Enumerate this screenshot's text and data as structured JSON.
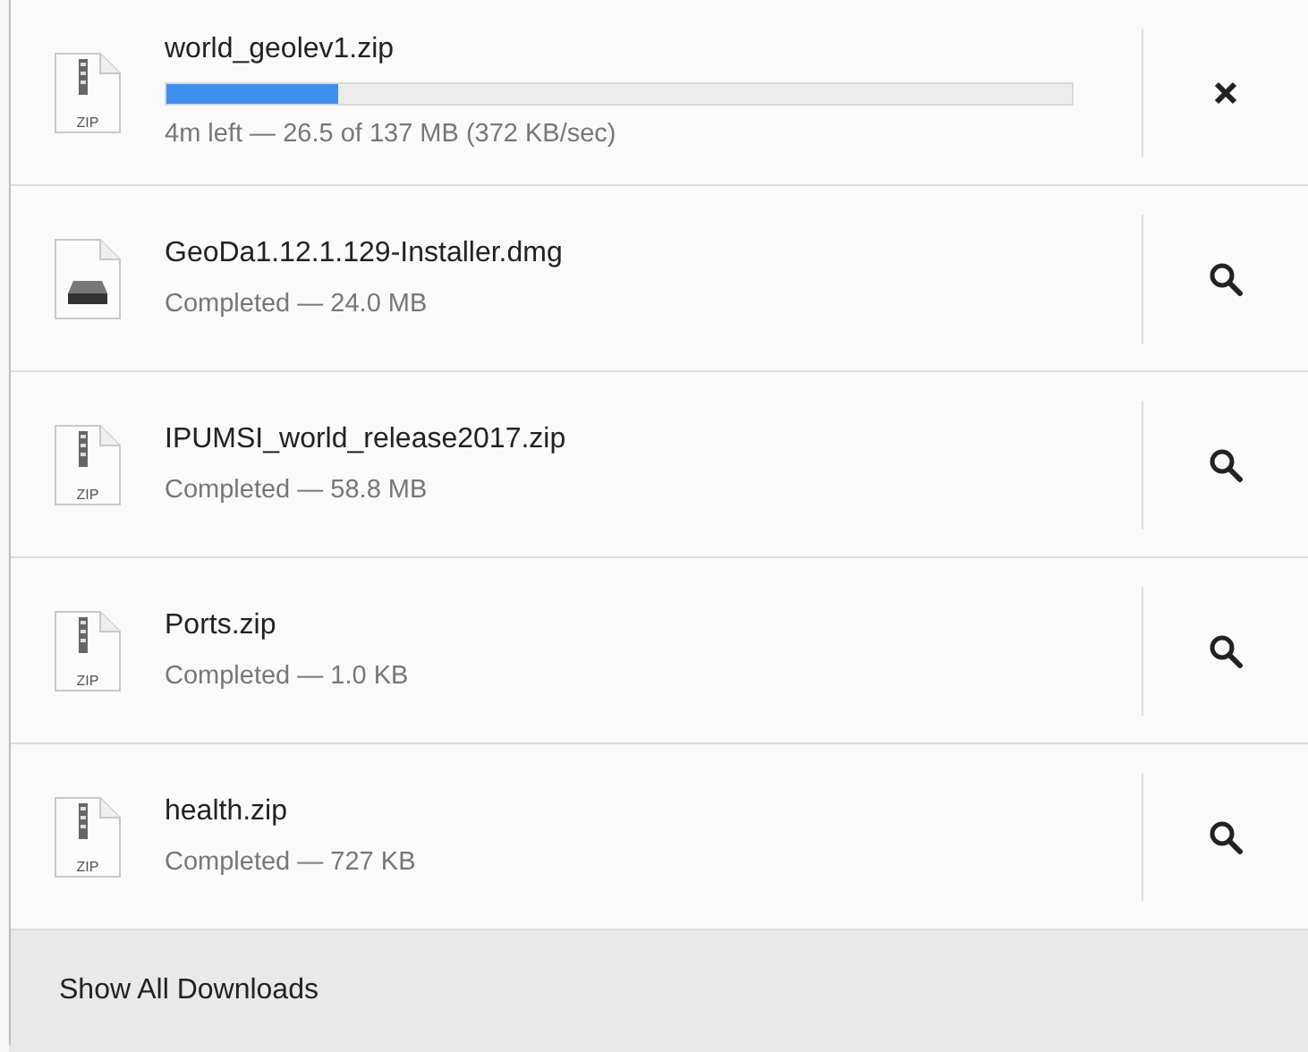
{
  "downloads": [
    {
      "kind": "zip",
      "icon_label": "ZIP",
      "name": "world_geolev1.zip",
      "status": "4m left — 26.5 of 137 MB (372 KB/sec)",
      "level": 0.19
    },
    {
      "kind": "dmg",
      "name": "GeoDa1.12.1.129-Installer.dmg",
      "status": "Completed — 24.0 MB"
    },
    {
      "kind": "zip",
      "icon_label": "ZIP",
      "name": "IPUMSI_world_release2017.zip",
      "status": "Completed — 58.8 MB"
    },
    {
      "kind": "zip",
      "icon_label": "ZIP",
      "name": "Ports.zip",
      "status": "Completed — 1.0 KB"
    },
    {
      "kind": "zip",
      "icon_label": "ZIP",
      "name": "health.zip",
      "status": "Completed — 727 KB"
    }
  ],
  "footer": {
    "label": "Show All Downloads"
  }
}
